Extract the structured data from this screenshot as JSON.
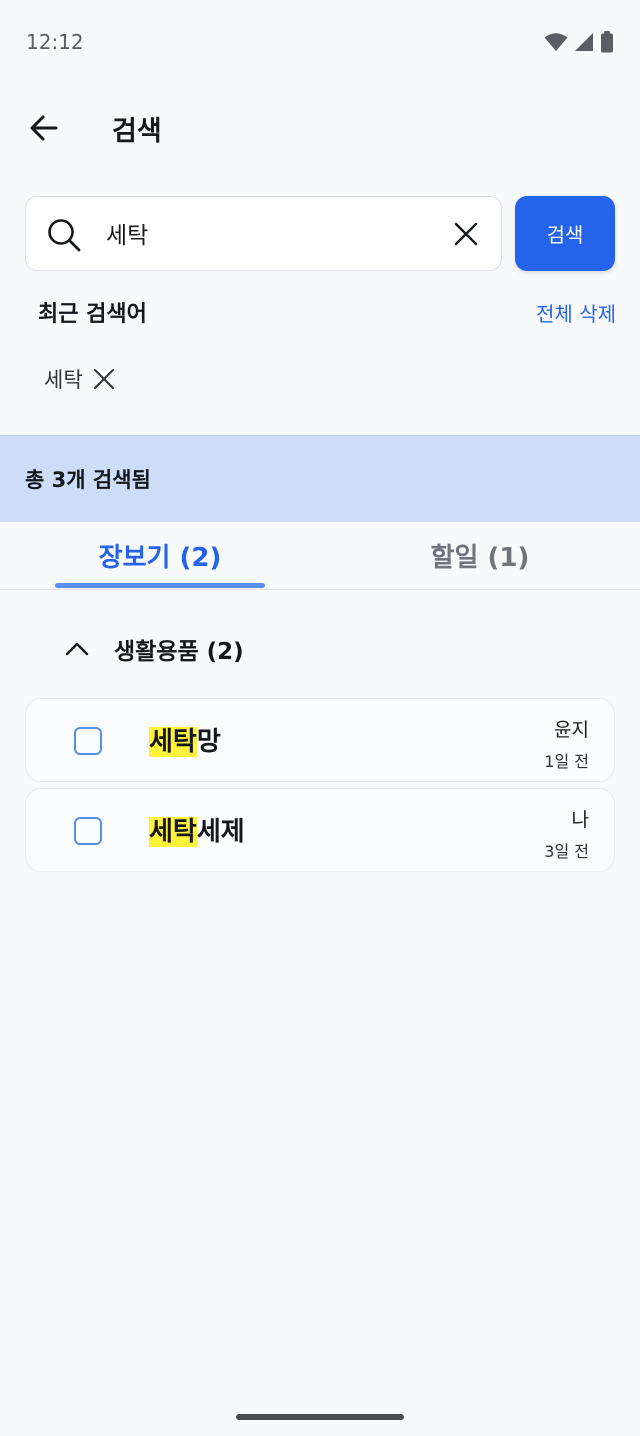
{
  "status_bar": {
    "time": "12:12"
  },
  "app_bar": {
    "title": "검색"
  },
  "search": {
    "value": "세탁",
    "button_label": "검색"
  },
  "recent": {
    "title": "최근 검색어",
    "clear_all_label": "전체 삭제",
    "items": [
      {
        "label": "세탁"
      }
    ]
  },
  "results": {
    "summary": "총 3개 검색됨"
  },
  "tabs": [
    {
      "label": "장보기 (2)",
      "active": true
    },
    {
      "label": "할일 (1)",
      "active": false
    }
  ],
  "category": {
    "label": "생활용품 (2)",
    "expanded": true
  },
  "items": [
    {
      "highlight": "세탁",
      "rest": "망",
      "owner": "윤지",
      "time": "1일 전",
      "checked": false
    },
    {
      "highlight": "세탁",
      "rest": "세제",
      "owner": "나",
      "time": "3일 전",
      "checked": false
    }
  ],
  "colors": {
    "accent": "#2563eb",
    "banner": "#cddcf7",
    "highlight": "#fff23a",
    "tab_indicator": "#5b8ee8"
  },
  "icons": {
    "back": "arrow-left-icon",
    "search": "search-icon",
    "clear": "close-icon",
    "chip_remove": "close-icon",
    "category_toggle": "chevron-up-icon",
    "wifi": "wifi-icon",
    "signal": "signal-icon",
    "battery": "battery-icon"
  }
}
